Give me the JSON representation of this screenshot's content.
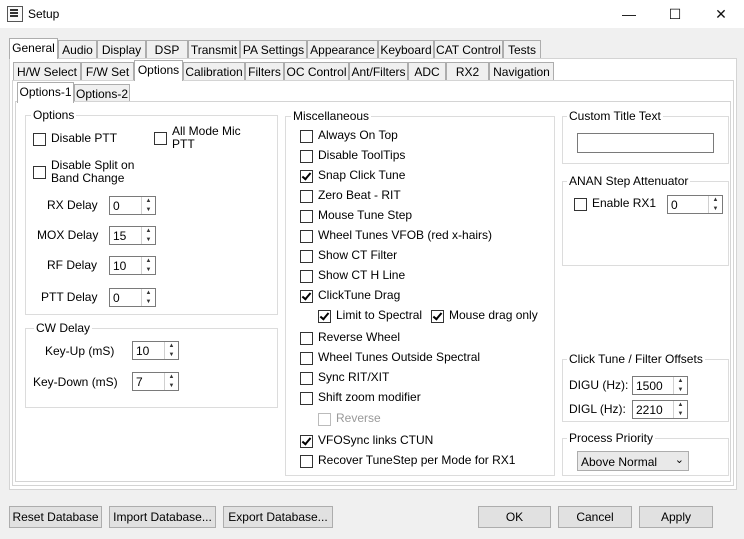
{
  "window": {
    "title": "Setup",
    "minimize": "—",
    "maximize": "☐",
    "close": "✕"
  },
  "main_tabs": [
    "General",
    "Audio",
    "Display",
    "DSP",
    "Transmit",
    "PA Settings",
    "Appearance",
    "Keyboard",
    "CAT Control",
    "Tests"
  ],
  "sub_tabs": [
    "H/W Select",
    "F/W Set",
    "Options",
    "Calibration",
    "Filters",
    "OC Control",
    "Ant/Filters",
    "ADC",
    "RX2",
    "Navigation"
  ],
  "options_tabs": [
    "Options-1",
    "Options-2"
  ],
  "options_group": {
    "title": "Options",
    "disable_ptt": "Disable PTT",
    "all_mode_mic_ptt_1": "All Mode Mic",
    "all_mode_mic_ptt_2": "PTT",
    "disable_split_1": "Disable Split on",
    "disable_split_2": "Band Change",
    "rx_delay_label": "RX Delay",
    "rx_delay": "0",
    "mox_delay_label": "MOX Delay",
    "mox_delay": "15",
    "rf_delay_label": "RF Delay",
    "rf_delay": "10",
    "ptt_delay_label": "PTT Delay",
    "ptt_delay": "0"
  },
  "cw_delay": {
    "title": "CW Delay",
    "key_up_label": "Key-Up (mS)",
    "key_up": "10",
    "key_down_label": "Key-Down (mS)",
    "key_down": "7"
  },
  "misc": {
    "title": "Miscellaneous",
    "items": [
      {
        "label": "Always On Top",
        "checked": false
      },
      {
        "label": "Disable ToolTips",
        "checked": false
      },
      {
        "label": "Snap Click Tune",
        "checked": true
      },
      {
        "label": "Zero Beat -  RIT",
        "checked": false
      },
      {
        "label": "Mouse Tune Step",
        "checked": false
      },
      {
        "label": "Wheel Tunes VFOB (red x-hairs)",
        "checked": false
      },
      {
        "label": "Show CT Filter",
        "checked": false
      },
      {
        "label": "Show CT H Line",
        "checked": false
      },
      {
        "label": "ClickTune Drag",
        "checked": true
      }
    ],
    "limit_to_spectral": "Limit to Spectral",
    "mouse_drag_only": "Mouse drag only",
    "items2": [
      {
        "label": "Reverse Wheel",
        "checked": false
      },
      {
        "label": "Wheel Tunes Outside Spectral",
        "checked": false
      },
      {
        "label": "Sync RIT/XIT",
        "checked": false
      },
      {
        "label": "Shift zoom modifier",
        "checked": false
      }
    ],
    "reverse": "Reverse",
    "vfosync": "VFOSync links CTUN",
    "recover": "Recover TuneStep per Mode for RX1"
  },
  "custom_title": {
    "title": "Custom Title Text",
    "value": ""
  },
  "anan": {
    "title": "ANAN Step Attenuator",
    "enable_rx1": "Enable RX1",
    "value": "0"
  },
  "click_tune": {
    "title": "Click Tune / Filter Offsets",
    "digu_label": "DIGU (Hz):",
    "digu": "1500",
    "digl_label": "DIGL (Hz):",
    "digl": "2210"
  },
  "process_priority": {
    "title": "Process Priority",
    "value": "Above Normal"
  },
  "buttons": {
    "reset": "Reset Database",
    "import": "Import Database...",
    "export": "Export Database...",
    "ok": "OK",
    "cancel": "Cancel",
    "apply": "Apply"
  }
}
